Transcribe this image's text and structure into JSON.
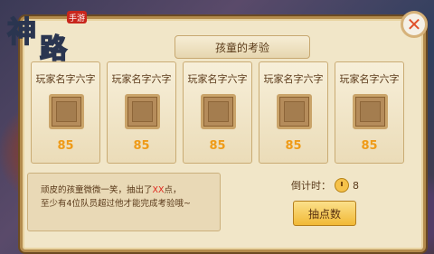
{
  "logo": {
    "text_main": "神",
    "text_second": "路",
    "text_small": "手游"
  },
  "dialog": {
    "title": "孩童的考验",
    "close_icon": "close-icon"
  },
  "cards": [
    {
      "name": "玩家名字六字",
      "score": "85"
    },
    {
      "name": "玩家名字六字",
      "score": "85"
    },
    {
      "name": "玩家名字六字",
      "score": "85"
    },
    {
      "name": "玩家名字六字",
      "score": "85"
    },
    {
      "name": "玩家名字六字",
      "score": "85"
    }
  ],
  "message": {
    "line1_prefix": "顽皮的孩童微微一笑，抽出了",
    "line1_highlight": "XX",
    "line1_suffix": "点，",
    "line2": "至少有4位队员超过他才能完成考验哦~"
  },
  "countdown": {
    "label": "倒计时：",
    "value": "8"
  },
  "roll_button": {
    "label": "抽点数"
  },
  "colors": {
    "score": "#ef9b18",
    "highlight": "#e0281e",
    "close_x": "#e0502a"
  }
}
